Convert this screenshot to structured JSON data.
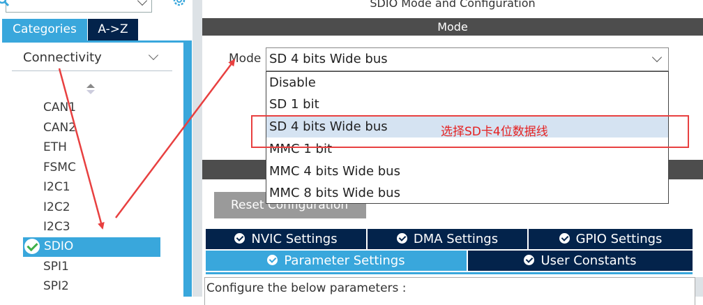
{
  "left_panel": {
    "search": {
      "value": ""
    },
    "tabs": {
      "categories": "Categories",
      "az": "A->Z"
    },
    "category": "Connectivity",
    "peripherals": [
      "CAN1",
      "CAN2",
      "ETH",
      "FSMC",
      "I2C1",
      "I2C2",
      "I2C3",
      "SDIO",
      "SPI1",
      "SPI2"
    ],
    "selected_peripheral": "SDIO"
  },
  "right_panel": {
    "title": "SDIO Mode and Configuration",
    "mode_header": "Mode",
    "mode_label": "Mode",
    "mode_value": "SD 4 bits Wide bus",
    "mode_options": [
      "Disable",
      "SD 1 bit",
      "SD 4 bits Wide bus",
      "MMC 1 bit",
      "MMC 4 bits Wide bus",
      "MMC 8 bits Wide bus"
    ],
    "highlighted_option": "SD 4 bits Wide bus",
    "reset_button": "Reset Configuration",
    "settings_tabs": {
      "nvic": "NVIC Settings",
      "dma": "DMA Settings",
      "gpio": "GPIO Settings",
      "parameter": "Parameter Settings",
      "user_constants": "User Constants"
    },
    "config_text": "Configure the below parameters :"
  },
  "annotation": {
    "text": "选择SD卡4位数据线"
  },
  "colors": {
    "accent": "#39a7dc",
    "navy": "#03234b",
    "header_gray": "#4d4d4d",
    "annotation_red": "#e52222"
  }
}
